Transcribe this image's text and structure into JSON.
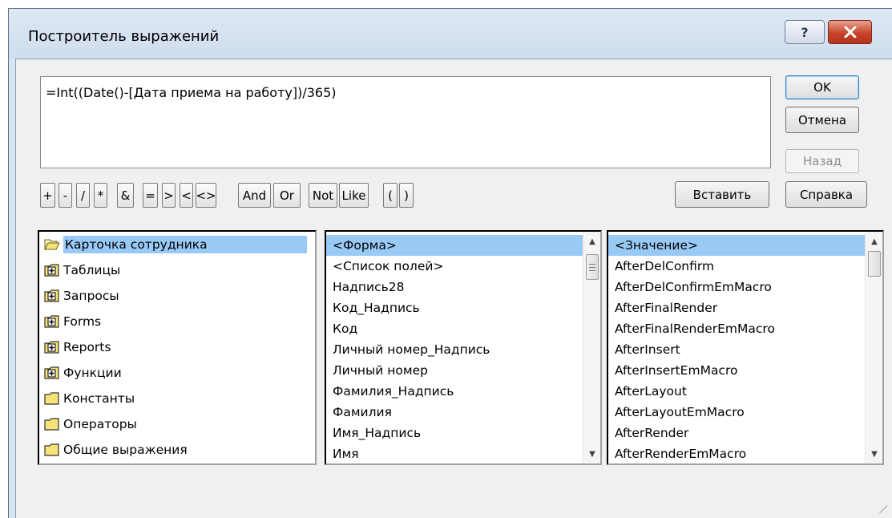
{
  "window": {
    "title": "Построитель выражений",
    "help_glyph": "?",
    "close_glyph": "✕"
  },
  "expression": "=Int((Date()-[Дата приема на работу])/365)",
  "buttons": {
    "ok": "OK",
    "cancel": "Отмена",
    "back": "Назад",
    "insert": "Вставить",
    "help": "Справка"
  },
  "operators": [
    "+",
    "-",
    "/",
    "*",
    "&",
    "=",
    ">",
    "<",
    "<>",
    "And",
    "Or",
    "Not",
    "Like",
    "(",
    ")"
  ],
  "tree": {
    "items": [
      {
        "label": "Карточка сотрудника",
        "icon": "open-folder-icon",
        "selected": true
      },
      {
        "label": "Таблицы",
        "icon": "plus-folder-icon"
      },
      {
        "label": "Запросы",
        "icon": "plus-folder-icon"
      },
      {
        "label": "Forms",
        "icon": "plus-folder-icon"
      },
      {
        "label": "Reports",
        "icon": "plus-folder-icon"
      },
      {
        "label": "Функции",
        "icon": "plus-folder-icon"
      },
      {
        "label": "Константы",
        "icon": "folder-icon"
      },
      {
        "label": "Операторы",
        "icon": "folder-icon"
      },
      {
        "label": "Общие выражения",
        "icon": "folder-icon"
      }
    ]
  },
  "middle_list": {
    "items": [
      "<Форма>",
      "<Список полей>",
      "Надпись28",
      "Код_Надпись",
      "Код",
      "Личный номер_Надпись",
      "Личный номер",
      "Фамилия_Надпись",
      "Фамилия",
      "Имя_Надпись",
      "Имя"
    ],
    "selected_index": 0
  },
  "right_list": {
    "items": [
      "<Значение>",
      "AfterDelConfirm",
      "AfterDelConfirmEmMacro",
      "AfterFinalRender",
      "AfterFinalRenderEmMacro",
      "AfterInsert",
      "AfterInsertEmMacro",
      "AfterLayout",
      "AfterLayoutEmMacro",
      "AfterRender",
      "AfterRenderEmMacro"
    ],
    "selected_index": 0
  },
  "colors": {
    "selection": "#99c9f5",
    "frame": "#d9e4f1",
    "close_button": "#c8452c"
  }
}
